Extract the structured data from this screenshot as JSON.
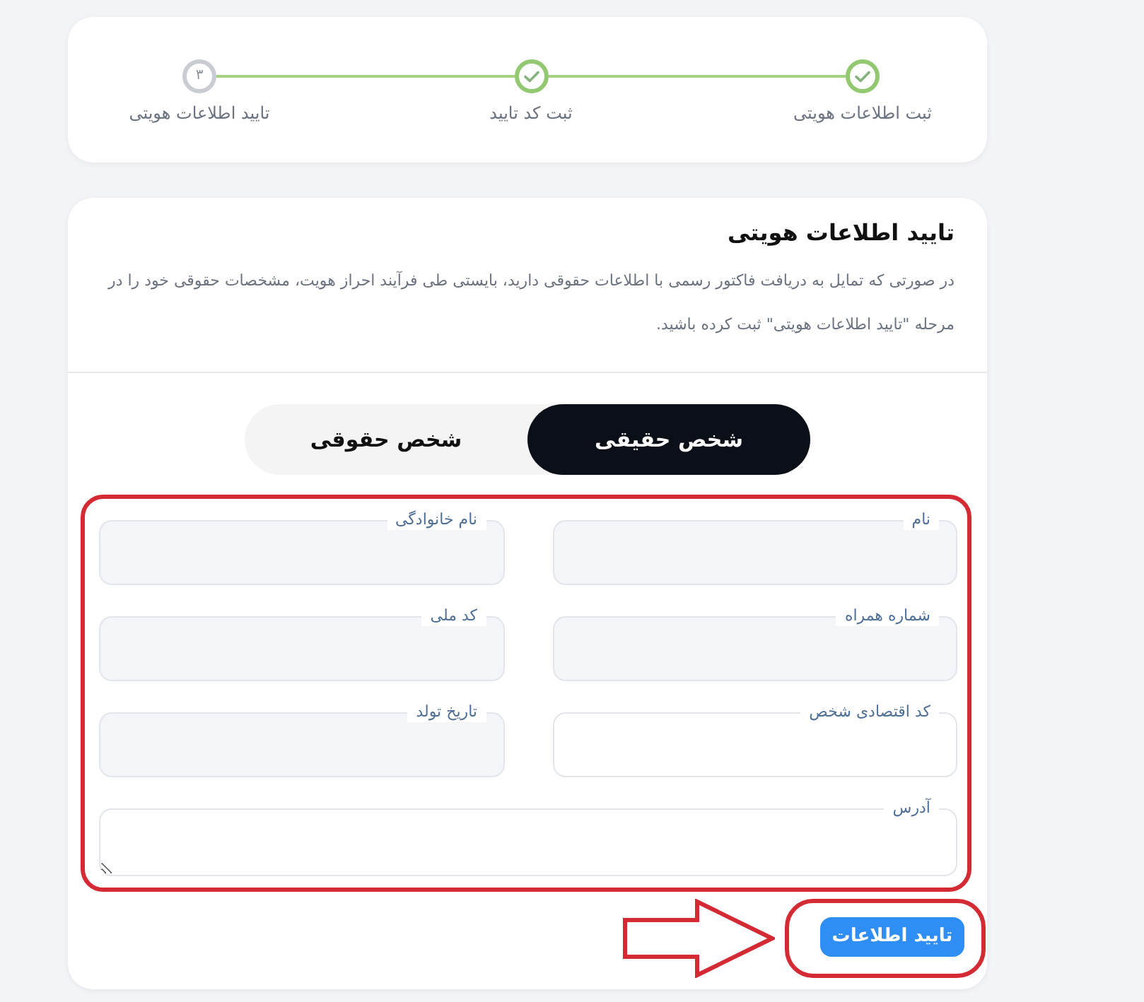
{
  "steps": [
    {
      "label": "ثبت اطلاعات هویتی",
      "done": true
    },
    {
      "label": "ثبت کد تایید",
      "done": true
    },
    {
      "label": "تایید اطلاعات هویتی",
      "done": false,
      "number": "۳"
    }
  ],
  "identity_card": {
    "title": "تایید اطلاعات هویتی",
    "description": "در صورتی که تمایل به دریافت فاکتور رسمی با اطلاعات حقوقی دارید، بایستی طی فرآیند احراز هویت، مشخصات حقوقی خود را در مرحله \"تایید اطلاعات هویتی\" ثبت کرده باشید.",
    "person_types": [
      {
        "label": "شخص حقیقی",
        "selected": true
      },
      {
        "label": "شخص حقوقی",
        "selected": false
      }
    ],
    "fields": [
      {
        "kind": "input",
        "label": "نام",
        "disabled": true
      },
      {
        "kind": "input",
        "label": "نام خانوادگی",
        "disabled": true
      },
      {
        "kind": "input",
        "label": "شماره همراه",
        "disabled": true
      },
      {
        "kind": "input",
        "label": "کد ملی",
        "disabled": true
      },
      {
        "kind": "input",
        "label": "کد اقتصادی شخص",
        "disabled": false
      },
      {
        "kind": "input",
        "label": "تاریخ تولد",
        "disabled": true
      },
      {
        "kind": "textarea",
        "label": "آدرس",
        "disabled": false
      }
    ],
    "submit_button": "تایید اطلاعات"
  }
}
